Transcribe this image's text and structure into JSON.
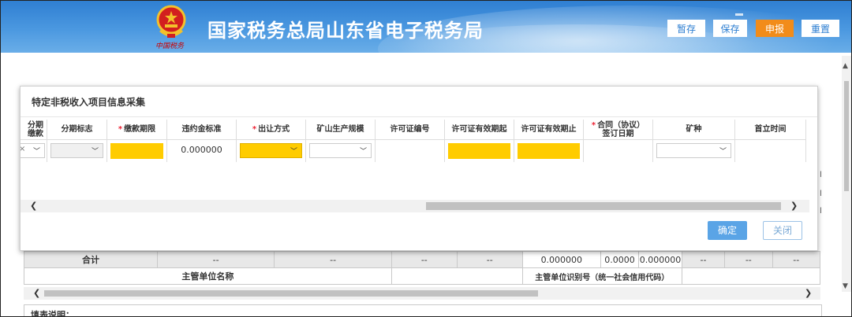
{
  "header": {
    "site_title": "国家税务总局山东省电子税务局",
    "emblem_caption": "中国税务",
    "buttons": {
      "save_draft": "暂存",
      "save": "保存",
      "submit": "申报",
      "reset": "重置"
    }
  },
  "dialog": {
    "title": "特定非税收入项目信息采集",
    "columns": [
      {
        "label": "分期缴款",
        "required": false,
        "input": "select",
        "value": "",
        "clipped": true
      },
      {
        "label": "分期标志",
        "required": false,
        "input": "select",
        "value": ""
      },
      {
        "label": "缴款期限",
        "required": true,
        "input": "highlighted-field",
        "value": ""
      },
      {
        "label": "违约金标准",
        "required": false,
        "input": "text",
        "value": "0.000000"
      },
      {
        "label": "出让方式",
        "required": true,
        "input": "highlighted-select",
        "value": ""
      },
      {
        "label": "矿山生产规模",
        "required": false,
        "input": "select",
        "value": ""
      },
      {
        "label": "许可证编号",
        "required": false,
        "input": "text",
        "value": ""
      },
      {
        "label": "许可证有效期起",
        "required": false,
        "input": "highlighted-field",
        "value": ""
      },
      {
        "label": "许可证有效期止",
        "required": false,
        "input": "highlighted-field",
        "value": ""
      },
      {
        "label": "合同（协议）签订日期",
        "required": true,
        "input": "text",
        "value": ""
      },
      {
        "label": "矿种",
        "required": false,
        "input": "select",
        "value": ""
      },
      {
        "label": "首立时间",
        "required": false,
        "input": "text",
        "value": ""
      }
    ],
    "required_mark": "*",
    "clear_mark": "×",
    "confirm_label": "确定",
    "close_label": "关闭"
  },
  "page": {
    "total_row": {
      "label": "合计",
      "cells": [
        "--",
        "--",
        "--",
        "--",
        "0.000000",
        "0.0000",
        "0.000000",
        "--",
        "--",
        "--"
      ]
    },
    "info_row": {
      "supervisor_name_label": "主管单位名称",
      "supervisor_id_label": "主管单位识别号（统一社会信用代码）"
    },
    "notes_label": "填表说明："
  },
  "colors": {
    "header_blue": "#3b8ad9",
    "highlight_yellow": "#ffcc00",
    "submit_orange": "#f28c1a",
    "confirm_blue": "#5aa4e6"
  },
  "icons": {
    "dropdown": "chevron-down-icon",
    "scroll_left": "scroll-left-arrow",
    "scroll_right": "scroll-right-arrow"
  }
}
